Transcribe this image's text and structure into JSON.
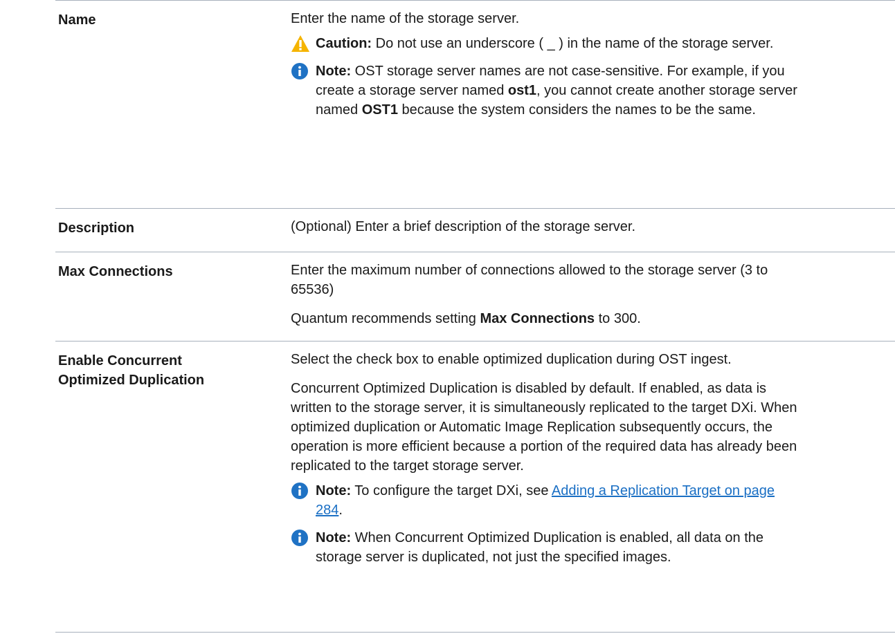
{
  "rows": [
    {
      "label": "Name",
      "para1": "Enter the name of the storage server.",
      "caution": {
        "prefix": "Caution:",
        "text": " Do not use an underscore ( _ ) in the name of the storage server."
      },
      "note": {
        "prefix": "Note:",
        "text_a": " OST storage server names are not case-sensitive. For example, if you create a storage server named ",
        "bold1": "ost1",
        "text_b": ", you cannot create another storage server named ",
        "bold2": "OST1",
        "text_c": " because the system considers the names to be the same."
      }
    },
    {
      "label": "Description",
      "para1": "(Optional) Enter a brief description of the storage server."
    },
    {
      "label": "Max Connections",
      "para1": "Enter the maximum number of connections allowed to the storage server (3 to 65536)",
      "para2_a": "Quantum recommends setting ",
      "para2_bold": "Max Connections",
      "para2_b": " to 300."
    },
    {
      "label": "Enable Concurrent Optimized Duplication",
      "para1": "Select the check box to enable optimized duplication during OST ingest.",
      "para2": "Concurrent Optimized Duplication is disabled by default. If enabled, as data is written to the storage server, it is simultaneously replicated to the target DXi. When optimized duplication or Automatic Image Replication subsequently occurs, the operation is more efficient because a portion of the required data has already been replicated to the target storage server.",
      "note1": {
        "prefix": "Note:",
        "text": " To configure the target DXi, see ",
        "link": "Adding a Replication Target on page 284",
        "suffix": "."
      },
      "note2": {
        "prefix": "Note:",
        "text": " When Concurrent Optimized Duplication is enabled, all data on the storage server is duplicated, not just the specified images."
      }
    }
  ],
  "icons": {
    "caution": "caution-icon",
    "note": "info-icon",
    "caution_color": "#f5b400",
    "note_color": "#1f72c4"
  }
}
